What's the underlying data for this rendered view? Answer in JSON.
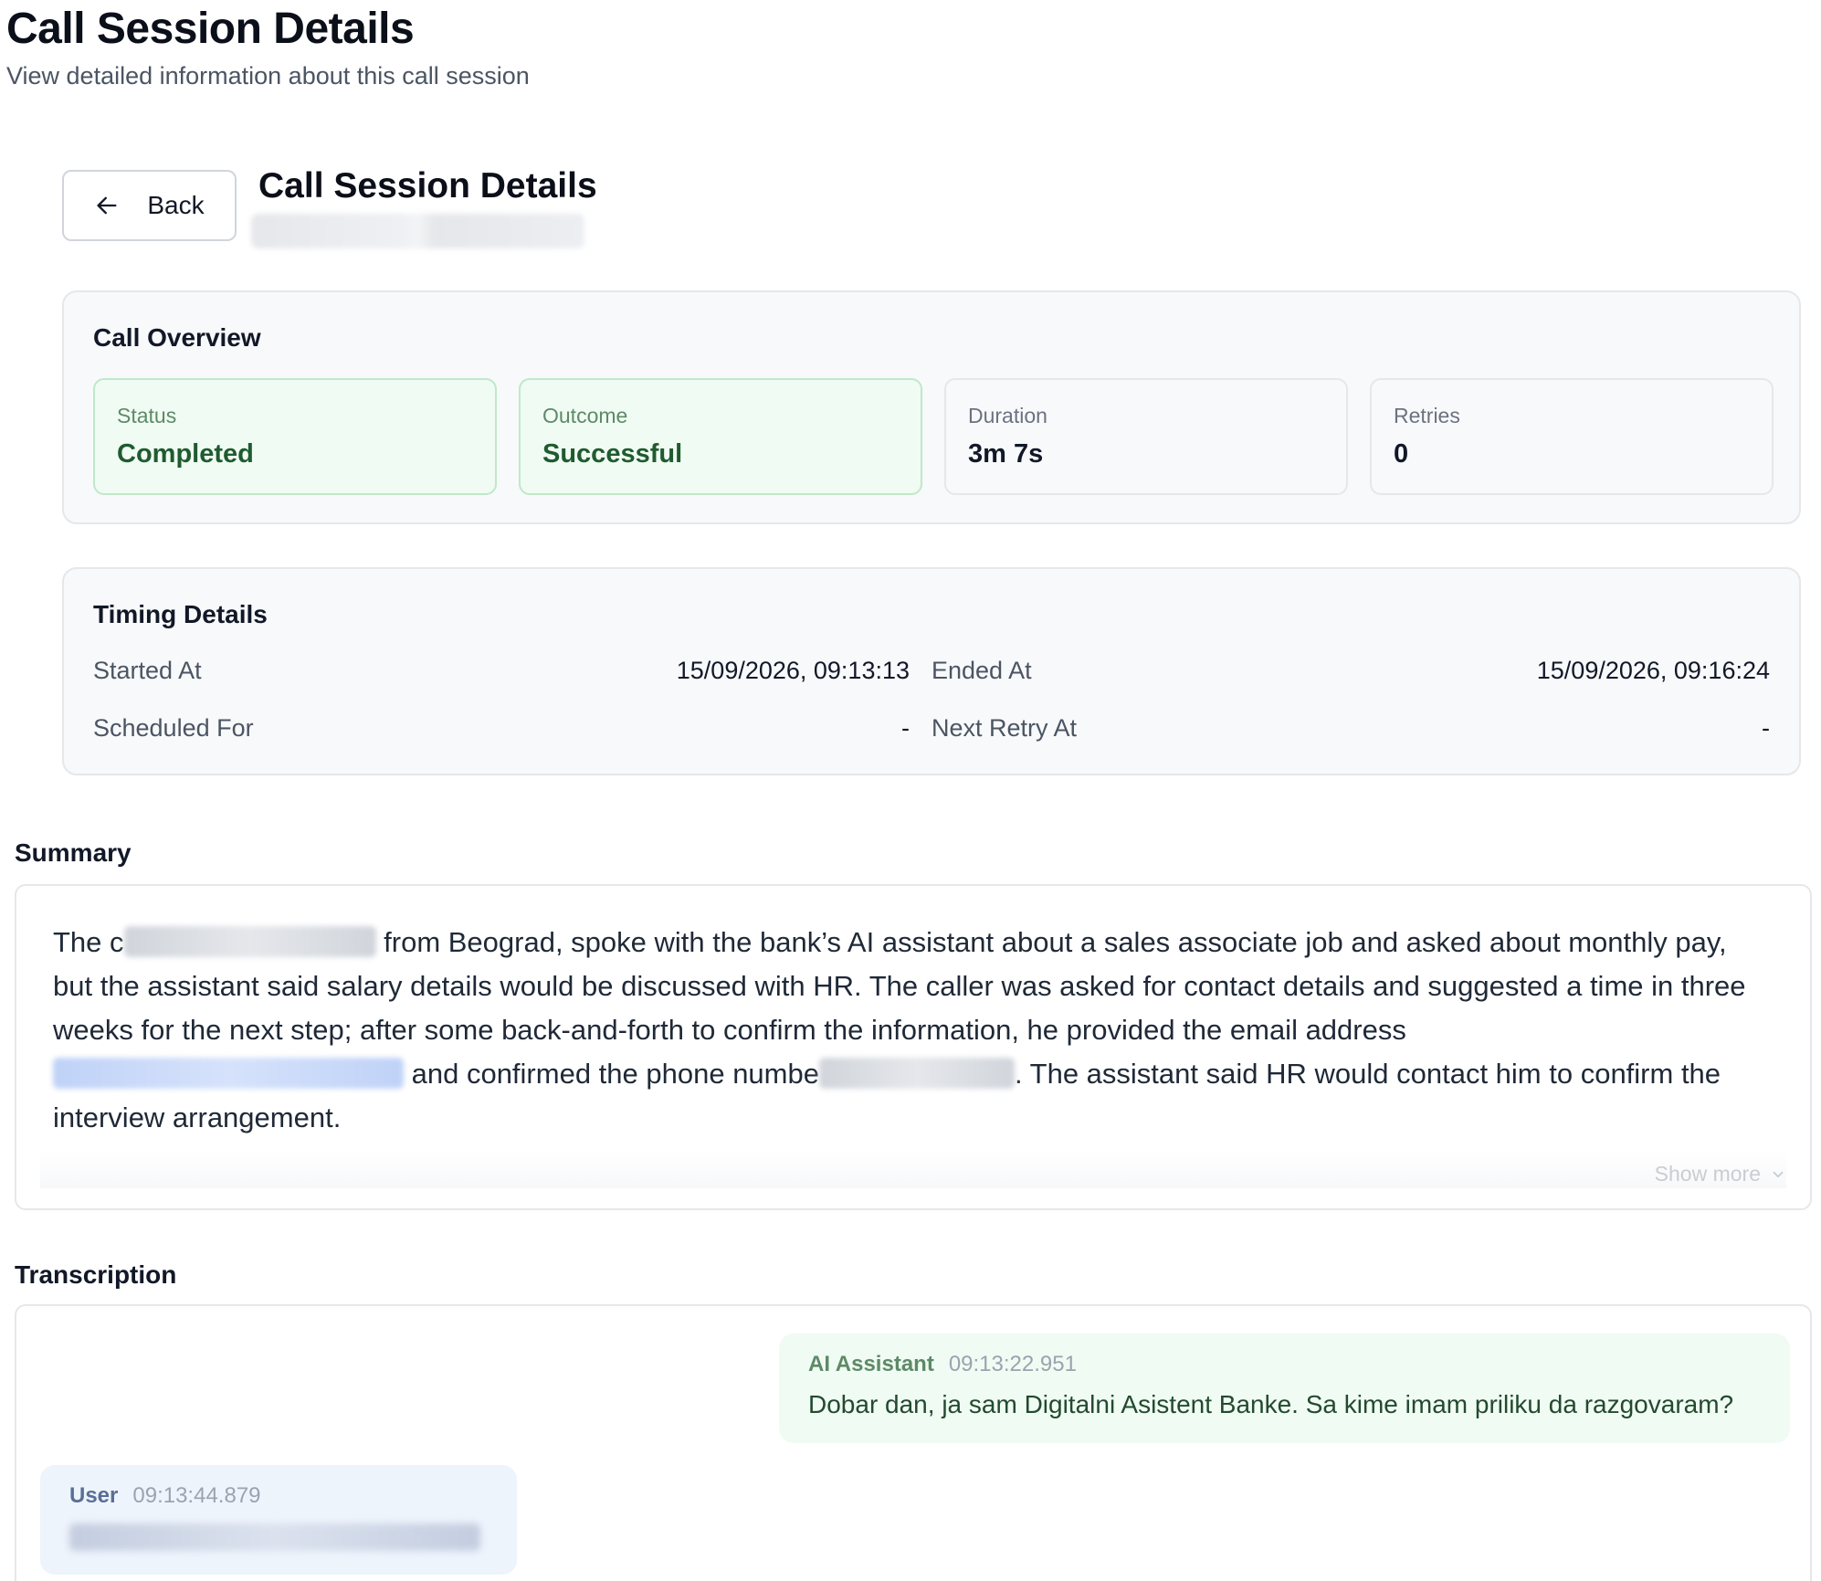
{
  "page": {
    "title": "Call Session Details",
    "subtitle": "View detailed information about this call session"
  },
  "header": {
    "back_label": "Back",
    "session_title": "Call Session Details"
  },
  "overview": {
    "title": "Call Overview",
    "stats": [
      {
        "label": "Status",
        "value": "Completed"
      },
      {
        "label": "Outcome",
        "value": "Successful"
      },
      {
        "label": "Duration",
        "value": "3m 7s"
      },
      {
        "label": "Retries",
        "value": "0"
      }
    ]
  },
  "timing": {
    "title": "Timing Details",
    "started_label": "Started At",
    "started_value": "15/09/2026, 09:13:13",
    "ended_label": "Ended At",
    "ended_value": "15/09/2026, 09:16:24",
    "scheduled_label": "Scheduled For",
    "scheduled_value": "-",
    "next_retry_label": "Next Retry At",
    "next_retry_value": "-"
  },
  "summary": {
    "title": "Summary",
    "part1": "The c",
    "part2": " from Beograd, spoke with the bank’s AI assistant about a sales associate job and asked about monthly pay, but the assistant said salary details would be discussed with HR. The caller was asked for contact details and suggested a time in three weeks for the next step; after some back-and-forth to confirm the information, he provided the email address ",
    "part3": " and confirmed the phone numbe",
    "part4": ". The assistant said HR would contact him to confirm the interview arrangement.",
    "show_more": "Show more"
  },
  "transcription": {
    "title": "Transcription",
    "messages": [
      {
        "speaker": "AI Assistant",
        "time": "09:13:22.951",
        "text": "Dobar dan, ja sam Digitalni Asistent Banke. Sa kime imam priliku da razgovaram?"
      },
      {
        "speaker": "User",
        "time": "09:13:44.879"
      }
    ]
  },
  "icons": {
    "back": "arrow-left-icon",
    "show_more": "chevron-down-icon"
  }
}
